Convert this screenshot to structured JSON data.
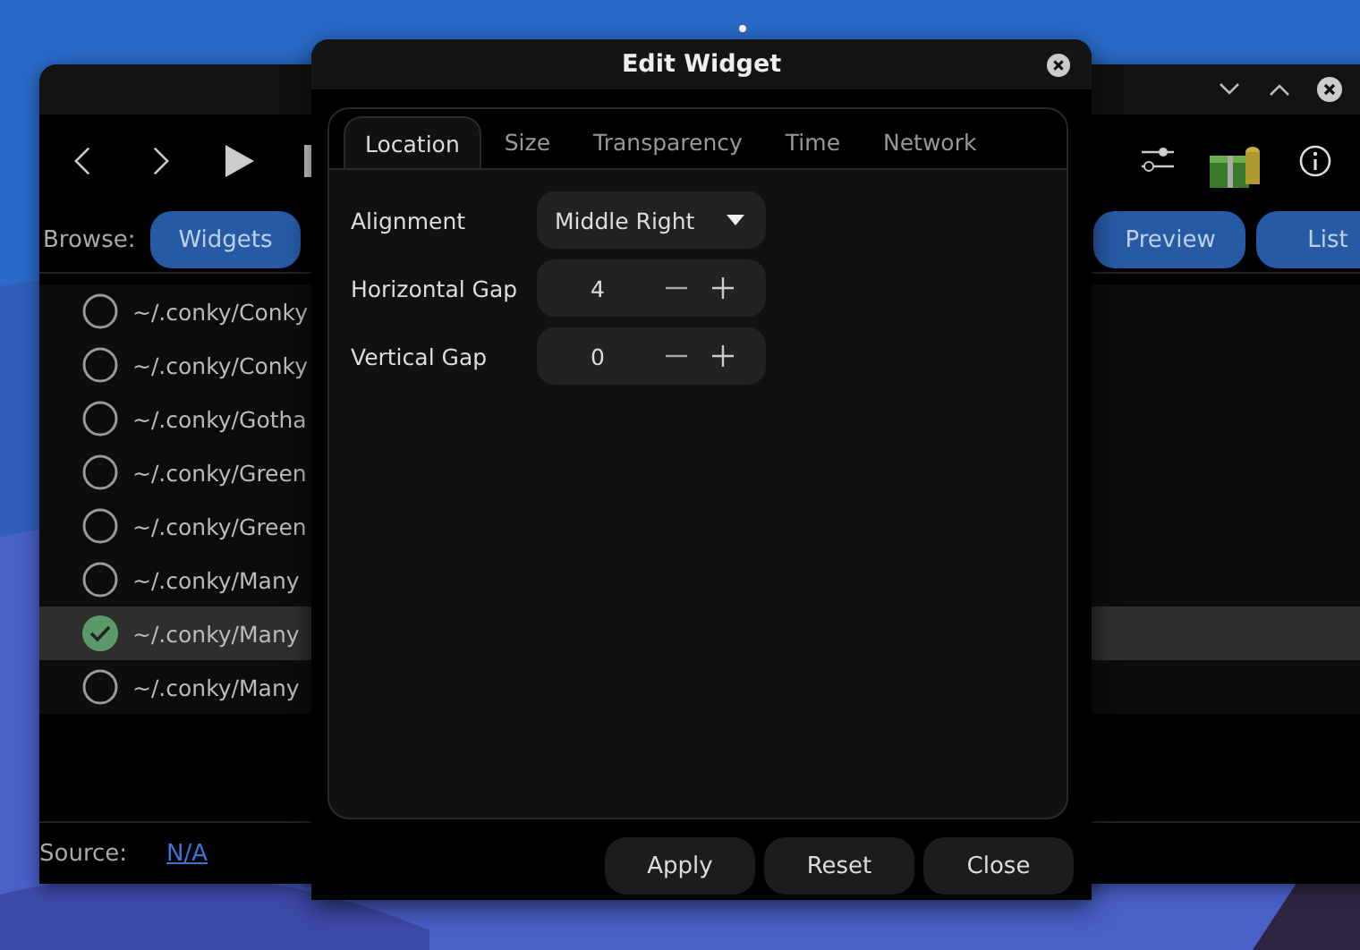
{
  "main_window": {
    "toolbar": {
      "browse_label": "Browse:",
      "browse_buttons": [
        {
          "label": "Widgets",
          "selected": true
        }
      ],
      "view_buttons": [
        {
          "label": "Preview"
        },
        {
          "label": "List"
        }
      ]
    },
    "widgets": [
      {
        "path": "~/.conky/Conky",
        "checked": false,
        "selected": false
      },
      {
        "path": "~/.conky/Conky",
        "checked": false,
        "selected": false
      },
      {
        "path": "~/.conky/Gotha",
        "checked": false,
        "selected": false
      },
      {
        "path": "~/.conky/Green",
        "checked": false,
        "selected": false
      },
      {
        "path": "~/.conky/Green",
        "checked": false,
        "selected": false
      },
      {
        "path": "~/.conky/Many",
        "checked": false,
        "selected": false
      },
      {
        "path": "~/.conky/Many",
        "checked": true,
        "selected": true
      },
      {
        "path": "~/.conky/Many",
        "checked": false,
        "selected": false
      }
    ],
    "source_label": "Source:",
    "source_link": "N/A"
  },
  "dialog": {
    "title": "Edit Widget",
    "tabs": [
      {
        "label": "Location",
        "selected": true
      },
      {
        "label": "Size",
        "selected": false
      },
      {
        "label": "Transparency",
        "selected": false
      },
      {
        "label": "Time",
        "selected": false
      },
      {
        "label": "Network",
        "selected": false
      }
    ],
    "fields": [
      {
        "kind": "dropdown",
        "label": "Alignment",
        "value": "Middle Right"
      },
      {
        "kind": "spin",
        "label": "Horizontal Gap",
        "value": "4"
      },
      {
        "kind": "spin",
        "label": "Vertical Gap",
        "value": "0"
      }
    ],
    "buttons": [
      "Apply",
      "Reset",
      "Close"
    ]
  }
}
